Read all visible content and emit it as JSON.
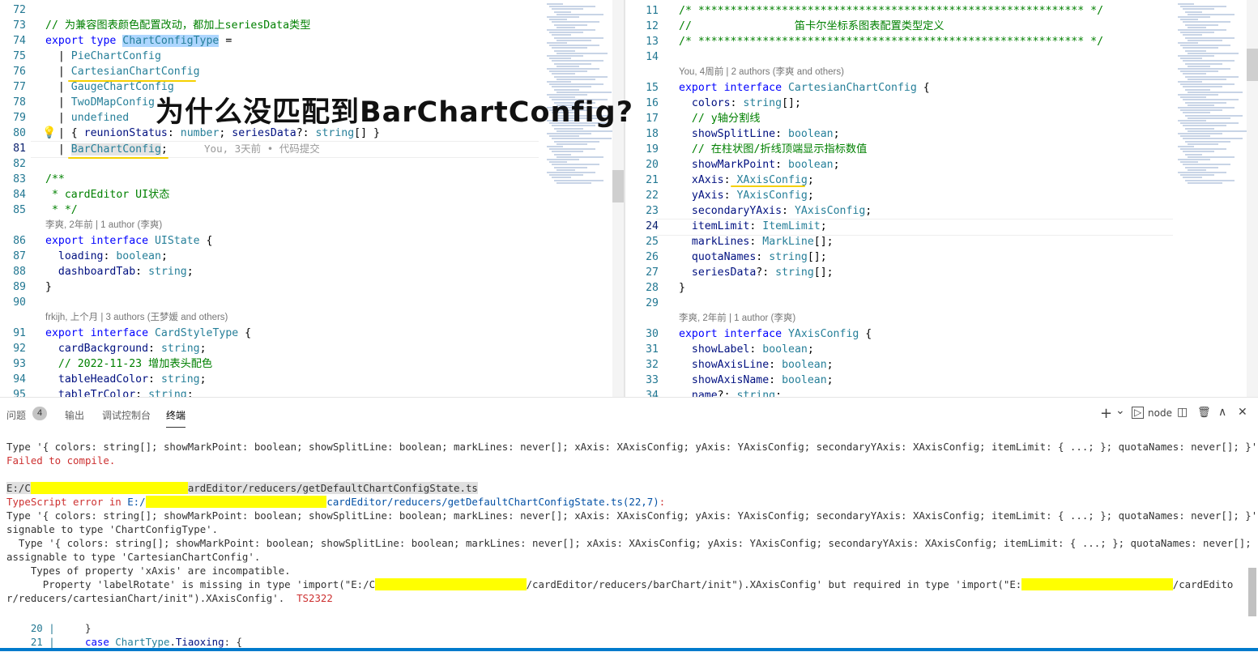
{
  "left_editor": {
    "lines": [
      {
        "n": "72",
        "parts": []
      },
      {
        "n": "73",
        "parts": [
          {
            "c": "cm",
            "t": "// 为兼容图表颜色配置改动，都加上seriesData类型"
          }
        ]
      },
      {
        "n": "74",
        "parts": [
          {
            "c": "kw",
            "t": "export type "
          },
          {
            "c": "ty sel",
            "t": "ChartConfigType"
          },
          {
            "c": "",
            "t": " ="
          }
        ]
      },
      {
        "n": "75",
        "parts": [
          {
            "c": "",
            "t": "  | "
          },
          {
            "c": "ty",
            "t": "PieChartConfig"
          }
        ]
      },
      {
        "n": "76",
        "parts": [
          {
            "c": "",
            "t": "  | "
          },
          {
            "c": "ty",
            "t": "CartesianChartConfig"
          }
        ]
      },
      {
        "n": "77",
        "parts": [
          {
            "c": "",
            "t": "  | "
          },
          {
            "c": "ty",
            "t": "GaugeChartConfig"
          }
        ]
      },
      {
        "n": "78",
        "parts": [
          {
            "c": "",
            "t": "  | "
          },
          {
            "c": "ty",
            "t": "TwoDMapConfig"
          }
        ]
      },
      {
        "n": "79",
        "parts": [
          {
            "c": "",
            "t": "  | "
          },
          {
            "c": "ty",
            "t": "undefined"
          }
        ]
      },
      {
        "n": "80",
        "parts": [
          {
            "c": "",
            "t": "  | { "
          },
          {
            "c": "pr",
            "t": "reunionStatus"
          },
          {
            "c": "",
            "t": ": "
          },
          {
            "c": "ty",
            "t": "number"
          },
          {
            "c": "",
            "t": "; "
          },
          {
            "c": "pr",
            "t": "seriesData"
          },
          {
            "c": "",
            "t": "?: "
          },
          {
            "c": "ty",
            "t": "string"
          },
          {
            "c": "",
            "t": "[] }"
          }
        ]
      },
      {
        "n": "81",
        "parts": [
          {
            "c": "",
            "t": "  | "
          },
          {
            "c": "ty sel2",
            "t": "BarChartConfig"
          },
          {
            "c": "",
            "t": ";"
          }
        ]
      },
      {
        "n": "82",
        "parts": []
      },
      {
        "n": "83",
        "parts": [
          {
            "c": "cm",
            "t": "/**"
          }
        ]
      },
      {
        "n": "84",
        "parts": [
          {
            "c": "cm",
            "t": " * cardEditor UI状态"
          }
        ]
      },
      {
        "n": "85",
        "parts": [
          {
            "c": "cm",
            "t": " * */"
          }
        ]
      },
      {
        "n": "86",
        "parts": [
          {
            "c": "kw",
            "t": "export interface "
          },
          {
            "c": "ty",
            "t": "UIState"
          },
          {
            "c": "",
            "t": " {"
          }
        ]
      },
      {
        "n": "87",
        "parts": [
          {
            "c": "",
            "t": "  "
          },
          {
            "c": "pr",
            "t": "loading"
          },
          {
            "c": "",
            "t": ": "
          },
          {
            "c": "ty",
            "t": "boolean"
          },
          {
            "c": "",
            "t": ";"
          }
        ]
      },
      {
        "n": "88",
        "parts": [
          {
            "c": "",
            "t": "  "
          },
          {
            "c": "pr",
            "t": "dashboardTab"
          },
          {
            "c": "",
            "t": ": "
          },
          {
            "c": "ty",
            "t": "string"
          },
          {
            "c": "",
            "t": ";"
          }
        ]
      },
      {
        "n": "89",
        "parts": [
          {
            "c": "",
            "t": "}"
          }
        ]
      },
      {
        "n": "90",
        "parts": []
      },
      {
        "n": "91",
        "parts": [
          {
            "c": "kw",
            "t": "export interface "
          },
          {
            "c": "ty",
            "t": "CardStyleType"
          },
          {
            "c": "",
            "t": " {"
          }
        ]
      },
      {
        "n": "92",
        "parts": [
          {
            "c": "",
            "t": "  "
          },
          {
            "c": "pr",
            "t": "cardBackground"
          },
          {
            "c": "",
            "t": ": "
          },
          {
            "c": "ty",
            "t": "string"
          },
          {
            "c": "",
            "t": ";"
          }
        ]
      },
      {
        "n": "93",
        "parts": [
          {
            "c": "",
            "t": "  "
          },
          {
            "c": "cm",
            "t": "// 2022-11-23 增加表头配色"
          }
        ]
      },
      {
        "n": "94",
        "parts": [
          {
            "c": "",
            "t": "  "
          },
          {
            "c": "pr",
            "t": "tableHeadColor"
          },
          {
            "c": "",
            "t": ": "
          },
          {
            "c": "ty",
            "t": "string"
          },
          {
            "c": "",
            "t": ";"
          }
        ]
      },
      {
        "n": "95",
        "parts": [
          {
            "c": "",
            "t": "  "
          },
          {
            "c": "pr",
            "t": "tableTrColor"
          },
          {
            "c": "",
            "t": ": "
          },
          {
            "c": "ty",
            "t": "string"
          },
          {
            "c": "",
            "t": ";"
          }
        ]
      }
    ],
    "blame_inline": "You, 3天前 • 代码提交",
    "lens_1": "李爽, 2年前 | 1 author (李爽)",
    "lens_2": "frkijh, 上个月 | 3 authors (王梦媛 and others)",
    "bulb_icon": "lightbulb-icon"
  },
  "right_editor": {
    "lines": [
      {
        "n": "11",
        "parts": [
          {
            "c": "cm",
            "t": "/* ************************************************************ */"
          }
        ]
      },
      {
        "n": "12",
        "parts": [
          {
            "c": "cm",
            "t": "//                笛卡尔坐标系图表配置类型定义"
          }
        ]
      },
      {
        "n": "13",
        "parts": [
          {
            "c": "cm",
            "t": "/* ************************************************************ */"
          }
        ]
      },
      {
        "n": "14",
        "parts": []
      },
      {
        "n": "15",
        "parts": [
          {
            "c": "kw",
            "t": "export interface "
          },
          {
            "c": "ty",
            "t": "CartesianChartConfig"
          },
          {
            "c": "",
            "t": " {"
          }
        ]
      },
      {
        "n": "16",
        "parts": [
          {
            "c": "",
            "t": "  "
          },
          {
            "c": "pr",
            "t": "colors"
          },
          {
            "c": "",
            "t": ": "
          },
          {
            "c": "ty",
            "t": "string"
          },
          {
            "c": "",
            "t": "[];"
          }
        ]
      },
      {
        "n": "17",
        "parts": [
          {
            "c": "",
            "t": "  "
          },
          {
            "c": "cm",
            "t": "// y轴分割线"
          }
        ]
      },
      {
        "n": "18",
        "parts": [
          {
            "c": "",
            "t": "  "
          },
          {
            "c": "pr",
            "t": "showSplitLine"
          },
          {
            "c": "",
            "t": ": "
          },
          {
            "c": "ty",
            "t": "boolean"
          },
          {
            "c": "",
            "t": ";"
          }
        ]
      },
      {
        "n": "19",
        "parts": [
          {
            "c": "",
            "t": "  "
          },
          {
            "c": "cm",
            "t": "// 在柱状图/折线顶端显示指标数值"
          }
        ]
      },
      {
        "n": "20",
        "parts": [
          {
            "c": "",
            "t": "  "
          },
          {
            "c": "pr",
            "t": "showMarkPoint"
          },
          {
            "c": "",
            "t": ": "
          },
          {
            "c": "ty",
            "t": "boolean"
          },
          {
            "c": "",
            "t": ";"
          }
        ]
      },
      {
        "n": "21",
        "parts": [
          {
            "c": "",
            "t": "  "
          },
          {
            "c": "pr",
            "t": "xAxis"
          },
          {
            "c": "",
            "t": ": "
          },
          {
            "c": "ty",
            "t": "XAxisConfig"
          },
          {
            "c": "",
            "t": ";"
          }
        ]
      },
      {
        "n": "22",
        "parts": [
          {
            "c": "",
            "t": "  "
          },
          {
            "c": "pr",
            "t": "yAxis"
          },
          {
            "c": "",
            "t": ": "
          },
          {
            "c": "ty",
            "t": "YAxisConfig"
          },
          {
            "c": "",
            "t": ";"
          }
        ]
      },
      {
        "n": "23",
        "parts": [
          {
            "c": "",
            "t": "  "
          },
          {
            "c": "pr",
            "t": "secondaryYAxis"
          },
          {
            "c": "",
            "t": ": "
          },
          {
            "c": "ty",
            "t": "YAxisConfig"
          },
          {
            "c": "",
            "t": ";"
          }
        ]
      },
      {
        "n": "24",
        "parts": [
          {
            "c": "",
            "t": "  "
          },
          {
            "c": "pr",
            "t": "itemLimit"
          },
          {
            "c": "",
            "t": ": "
          },
          {
            "c": "ty",
            "t": "ItemLimit"
          },
          {
            "c": "",
            "t": ";"
          }
        ]
      },
      {
        "n": "25",
        "parts": [
          {
            "c": "",
            "t": "  "
          },
          {
            "c": "pr",
            "t": "markLines"
          },
          {
            "c": "",
            "t": ": "
          },
          {
            "c": "ty",
            "t": "MarkLine"
          },
          {
            "c": "",
            "t": "[];"
          }
        ]
      },
      {
        "n": "26",
        "parts": [
          {
            "c": "",
            "t": "  "
          },
          {
            "c": "pr",
            "t": "quotaNames"
          },
          {
            "c": "",
            "t": ": "
          },
          {
            "c": "ty",
            "t": "string"
          },
          {
            "c": "",
            "t": "[];"
          }
        ]
      },
      {
        "n": "27",
        "parts": [
          {
            "c": "",
            "t": "  "
          },
          {
            "c": "pr",
            "t": "seriesData"
          },
          {
            "c": "",
            "t": "?: "
          },
          {
            "c": "ty",
            "t": "string"
          },
          {
            "c": "",
            "t": "[];"
          }
        ]
      },
      {
        "n": "28",
        "parts": [
          {
            "c": "",
            "t": "}"
          }
        ]
      },
      {
        "n": "29",
        "parts": []
      },
      {
        "n": "30",
        "parts": [
          {
            "c": "kw",
            "t": "export interface "
          },
          {
            "c": "ty",
            "t": "YAxisConfig"
          },
          {
            "c": "",
            "t": " {"
          }
        ]
      },
      {
        "n": "31",
        "parts": [
          {
            "c": "",
            "t": "  "
          },
          {
            "c": "pr",
            "t": "showLabel"
          },
          {
            "c": "",
            "t": ": "
          },
          {
            "c": "ty",
            "t": "boolean"
          },
          {
            "c": "",
            "t": ";"
          }
        ]
      },
      {
        "n": "32",
        "parts": [
          {
            "c": "",
            "t": "  "
          },
          {
            "c": "pr",
            "t": "showAxisLine"
          },
          {
            "c": "",
            "t": ": "
          },
          {
            "c": "ty",
            "t": "boolean"
          },
          {
            "c": "",
            "t": ";"
          }
        ]
      },
      {
        "n": "33",
        "parts": [
          {
            "c": "",
            "t": "  "
          },
          {
            "c": "pr",
            "t": "showAxisName"
          },
          {
            "c": "",
            "t": ": "
          },
          {
            "c": "ty",
            "t": "boolean"
          },
          {
            "c": "",
            "t": ";"
          }
        ]
      },
      {
        "n": "34",
        "parts": [
          {
            "c": "",
            "t": "  "
          },
          {
            "c": "pr",
            "t": "name"
          },
          {
            "c": "",
            "t": "?: "
          },
          {
            "c": "ty",
            "t": "string"
          },
          {
            "c": "",
            "t": ";"
          }
        ]
      }
    ],
    "lens_1": "You, 4周前 | 2 authors (李爽 and others)",
    "lens_2": "李爽, 2年前 | 1 author (李爽)"
  },
  "overlay_title": "为什么没匹配到BarChartConfig?",
  "panel": {
    "tabs": {
      "problems": "问题",
      "problems_count": "4",
      "output": "输出",
      "debug_console": "调试控制台",
      "terminal": "终端"
    },
    "toolbar": {
      "add": "+",
      "dropdown": "⌄",
      "terminal_icon": "▷",
      "node": "node",
      "split": "◫",
      "trash": "🗑",
      "maximize": "∧",
      "close": "✕"
    },
    "terminal_lines": [
      {
        "parts": [
          {
            "c": "",
            "t": "Type '{ colors: string[]; showMarkPoint: boolean; showSplitLine: boolean; markLines: never[]; xAxis: XAxisConfig; yAxis: YAxisConfig; secondaryYAxis: XAxisConfig; itemLimit: { ...; }; quotaNames: never[]; }' is not as"
          }
        ]
      },
      {
        "parts": [
          {
            "c": "err",
            "t": "Failed to compile."
          }
        ]
      },
      {
        "parts": []
      },
      {
        "parts": [
          {
            "c": "hl",
            "t": "E:/C"
          },
          {
            "c": "mask",
            "t": "                          "
          },
          {
            "c": "hl",
            "t": "ardEditor/reducers/getDefaultChartConfigState.ts"
          }
        ]
      },
      {
        "parts": [
          {
            "c": "err",
            "t": "TypeScript error in "
          },
          {
            "c": "link",
            "t": "E:/"
          },
          {
            "c": "mask",
            "t": "                              "
          },
          {
            "c": "link",
            "t": "cardEditor/reducers/getDefaultChartConfigState.ts(22,7)"
          },
          {
            "c": "err",
            "t": ":"
          }
        ]
      },
      {
        "parts": [
          {
            "c": "",
            "t": "Type '{ colors: string[]; showMarkPoint: boolean; showSplitLine: boolean; markLines: never[]; xAxis: XAxisConfig; yAxis: YAxisConfig; secondaryYAxis: XAxisConfig; itemLimit: { ...; }; quotaNames: never[]; }' is not as"
          }
        ]
      },
      {
        "parts": [
          {
            "c": "",
            "t": "signable to type 'ChartConfigType'."
          }
        ]
      },
      {
        "parts": [
          {
            "c": "",
            "t": "  Type '{ colors: string[]; showMarkPoint: boolean; showSplitLine: boolean; markLines: never[]; xAxis: XAxisConfig; yAxis: YAxisConfig; secondaryYAxis: XAxisConfig; itemLimit: { ...; }; quotaNames: never[]; }' is not"
          }
        ]
      },
      {
        "parts": [
          {
            "c": "",
            "t": "assignable to type 'CartesianChartConfig'."
          }
        ]
      },
      {
        "parts": [
          {
            "c": "",
            "t": "    Types of property 'xAxis' are incompatible."
          }
        ]
      },
      {
        "parts": [
          {
            "c": "",
            "t": "      Property 'labelRotate' is missing in type 'import(\"E:/C"
          },
          {
            "c": "mask",
            "t": "                         "
          },
          {
            "c": "",
            "t": "/cardEditor/reducers/barChart/init\").XAxisConfig' but required in type 'import(\"E:"
          },
          {
            "c": "mask",
            "t": "                         "
          },
          {
            "c": "",
            "t": "/cardEdito"
          }
        ]
      },
      {
        "parts": [
          {
            "c": "",
            "t": "r/reducers/cartesianChart/init\").XAxisConfig'.  "
          },
          {
            "c": "err",
            "t": "TS2322"
          }
        ]
      },
      {
        "parts": []
      },
      {
        "parts": [
          {
            "c": "snip-ln",
            "t": "    20 |     "
          },
          {
            "c": "",
            "t": "}"
          }
        ]
      },
      {
        "parts": [
          {
            "c": "snip-ln",
            "t": "    21 |     "
          },
          {
            "c": "kw",
            "t": "case "
          },
          {
            "c": "ty",
            "t": "ChartType"
          },
          {
            "c": "",
            "t": "."
          },
          {
            "c": "pr",
            "t": "Tiaoxing"
          },
          {
            "c": "",
            "t": ": {"
          }
        ]
      }
    ]
  }
}
